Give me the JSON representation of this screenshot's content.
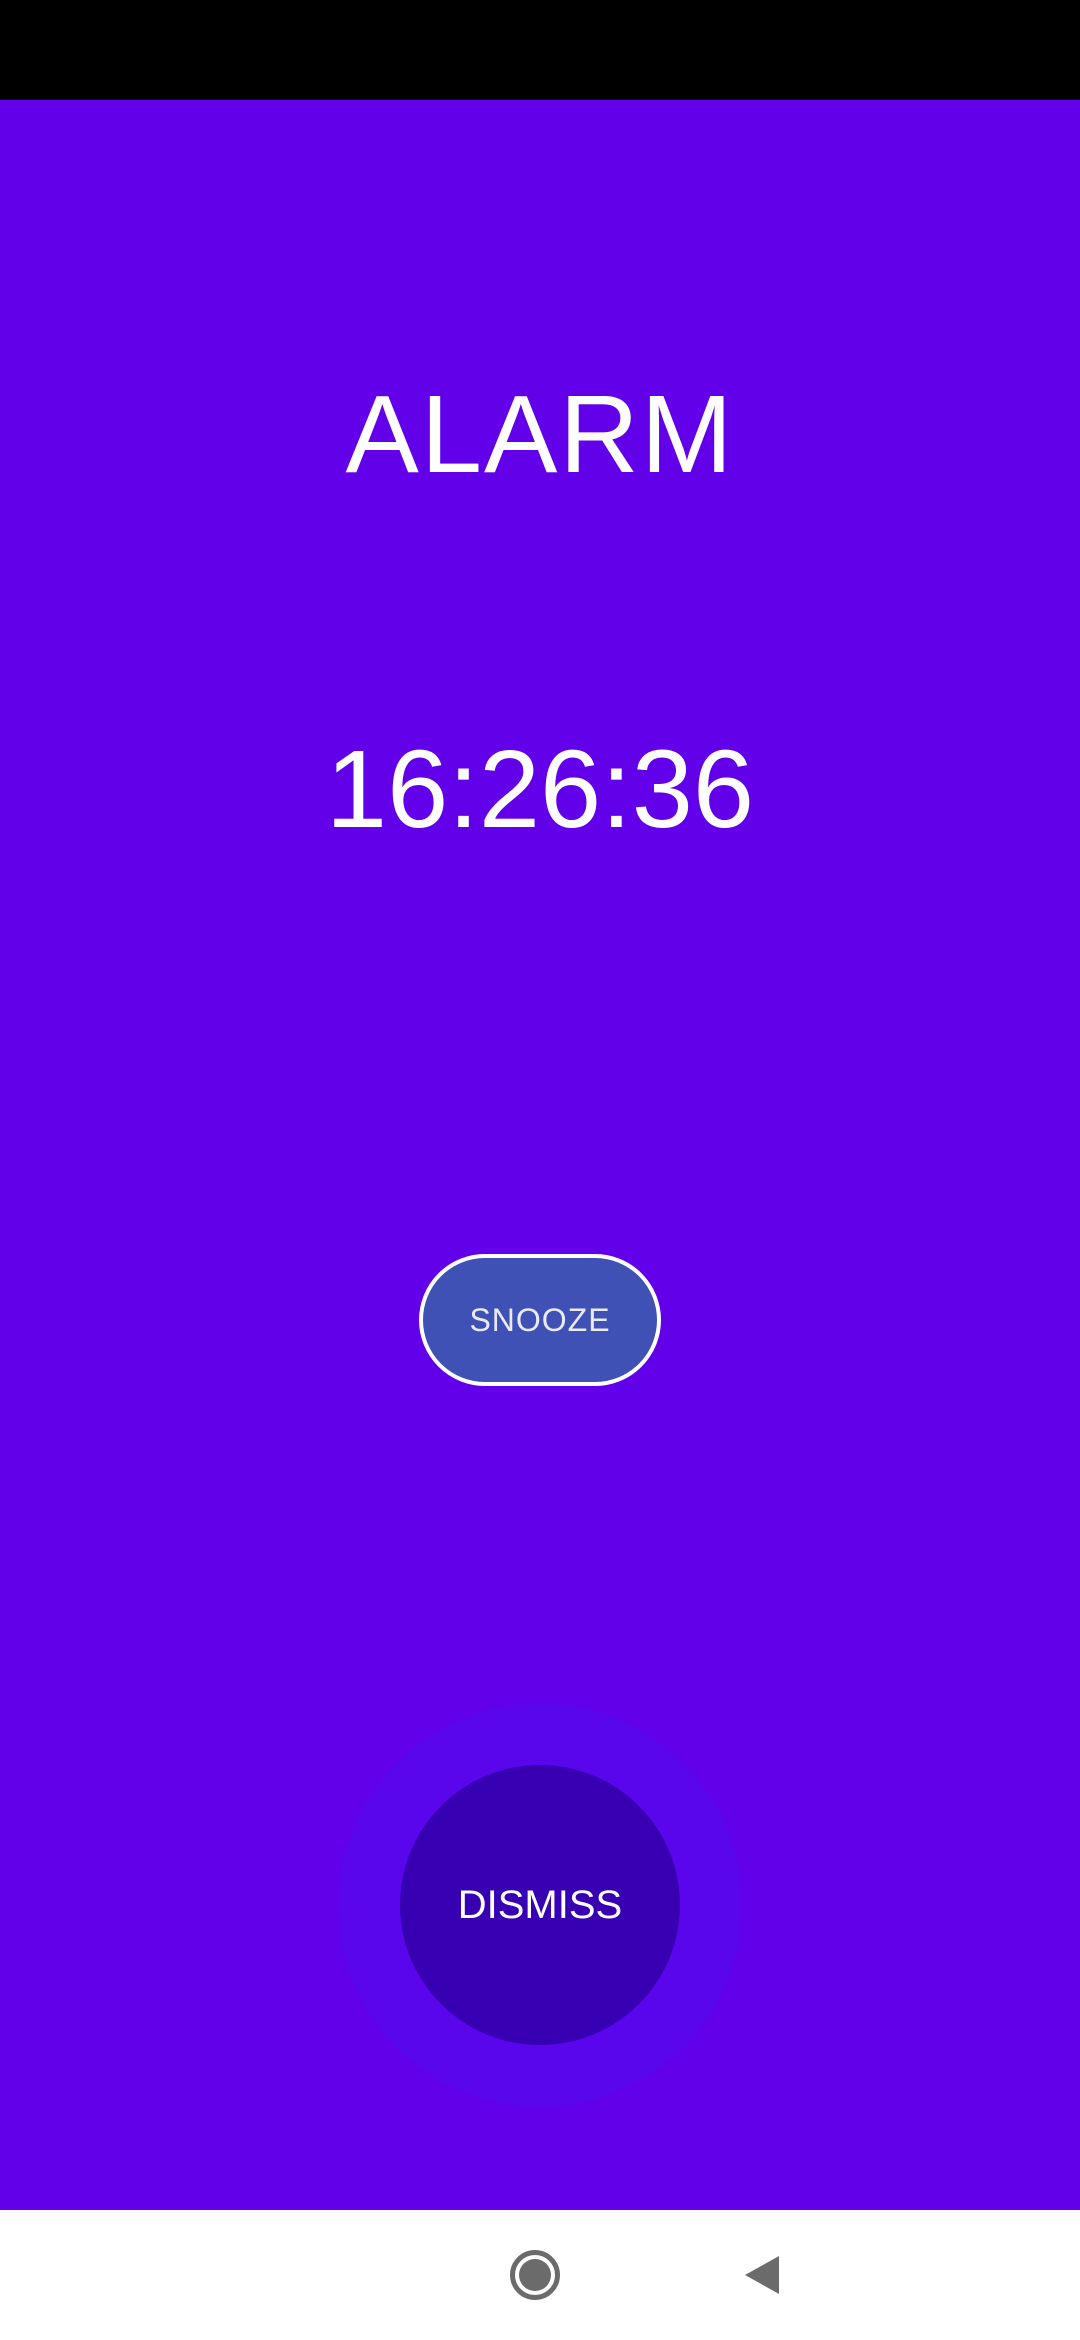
{
  "alarm": {
    "title": "ALARM",
    "time": "16:26:36",
    "snooze_label": "SNOOZE",
    "dismiss_label": "DISMISS"
  },
  "colors": {
    "background": "#6200EA",
    "snooze_button": "#3F51B5",
    "dismiss_button": "#3700B3",
    "text": "#FFFFFF"
  },
  "navigation": {
    "icons": [
      "home-icon",
      "back-icon"
    ]
  }
}
